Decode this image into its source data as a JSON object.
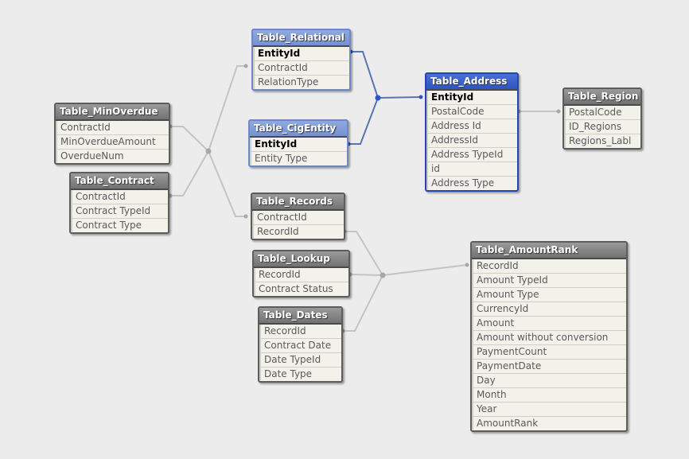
{
  "tables": [
    {
      "name": "Table_Relational",
      "fields": [
        "EntityId",
        "ContractId",
        "RelationType"
      ],
      "keys": [
        "EntityId"
      ],
      "style": "linked"
    },
    {
      "name": "Table_CigEntity",
      "fields": [
        "EntityId",
        "Entity Type"
      ],
      "keys": [
        "EntityId"
      ],
      "style": "linked"
    },
    {
      "name": "Table_Address",
      "fields": [
        "EntityId",
        "PostalCode",
        "Address Id",
        "AddressId",
        "Address TypeId",
        "id",
        "Address Type"
      ],
      "keys": [
        "EntityId"
      ],
      "style": "selected"
    },
    {
      "name": "Table_Region",
      "fields": [
        "PostalCode",
        "ID_Regions",
        "Regions_Labl"
      ],
      "keys": [],
      "style": "normal"
    },
    {
      "name": "Table_MinOverdue",
      "fields": [
        "ContractId",
        "MinOverdueAmount",
        "OverdueNum"
      ],
      "keys": [],
      "style": "normal"
    },
    {
      "name": "Table_Contract",
      "fields": [
        "ContractId",
        "Contract TypeId",
        "Contract Type"
      ],
      "keys": [],
      "style": "normal"
    },
    {
      "name": "Table_Records",
      "fields": [
        "ContractId",
        "RecordId"
      ],
      "keys": [],
      "style": "normal"
    },
    {
      "name": "Table_Lookup",
      "fields": [
        "RecordId",
        "Contract Status"
      ],
      "keys": [],
      "style": "normal"
    },
    {
      "name": "Table_Dates",
      "fields": [
        "RecordId",
        "Contract Date",
        "Date TypeId",
        "Date Type"
      ],
      "keys": [],
      "style": "normal"
    },
    {
      "name": "Table_AmountRank",
      "fields": [
        "RecordId",
        "Amount TypeId",
        "Amount Type",
        "CurrencyId",
        "Amount",
        "Amount without conversion",
        "PaymentCount",
        "PaymentDate",
        "Day",
        "Month",
        "Year",
        "AmountRank"
      ],
      "keys": [],
      "style": "normal"
    }
  ],
  "colors": {
    "background": "#ececec",
    "link_gray": "#c4c4c4",
    "link_blue": "#5b73b0",
    "selected_header": "#2f55c2"
  }
}
